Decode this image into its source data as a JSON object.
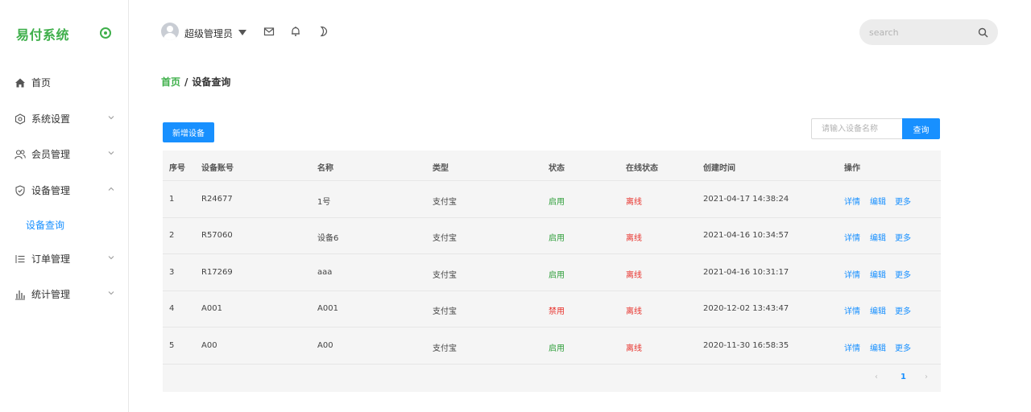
{
  "app": {
    "title": "易付系统"
  },
  "sidebar": {
    "items": [
      {
        "label": "首页",
        "icon": "home-icon"
      },
      {
        "label": "系统设置",
        "icon": "settings-icon"
      },
      {
        "label": "会员管理",
        "icon": "users-icon"
      },
      {
        "label": "设备管理",
        "icon": "shield-icon"
      },
      {
        "label": "订单管理",
        "icon": "list-icon"
      },
      {
        "label": "统计管理",
        "icon": "bar-chart-icon"
      }
    ],
    "sub_active": "设备查询"
  },
  "topbar": {
    "username": "超级管理员",
    "search_placeholder": "search"
  },
  "breadcrumb": {
    "home": "首页",
    "separator": "/",
    "current": "设备查询"
  },
  "toolbar": {
    "add_label": "新增设备",
    "query_placeholder": "请输入设备名称",
    "query_label": "查询"
  },
  "table": {
    "headers": [
      "序号",
      "设备账号",
      "名称",
      "类型",
      "状态",
      "在线状态",
      "创建时间",
      "操作"
    ],
    "rows": [
      {
        "idx": "1",
        "account": "R24677",
        "name": "1号",
        "type": "支付宝",
        "status": "启用",
        "online": "离线",
        "created": "2021-04-17 14:38:24"
      },
      {
        "idx": "2",
        "account": "R57060",
        "name": "设备6",
        "type": "支付宝",
        "status": "启用",
        "online": "离线",
        "created": "2021-04-16 10:34:57"
      },
      {
        "idx": "3",
        "account": "R17269",
        "name": "aaa",
        "type": "支付宝",
        "status": "启用",
        "online": "离线",
        "created": "2021-04-16 10:31:17"
      },
      {
        "idx": "4",
        "account": "A001",
        "name": "A001",
        "type": "支付宝",
        "status": "禁用",
        "online": "离线",
        "created": "2020-12-02 13:43:47"
      },
      {
        "idx": "5",
        "account": "A00",
        "name": "A00",
        "type": "支付宝",
        "status": "启用",
        "online": "离线",
        "created": "2020-11-30 16:58:35"
      }
    ],
    "actions": [
      "详情",
      "编辑",
      "更多"
    ]
  },
  "pagination": {
    "prev": "‹",
    "page": "1",
    "next": "›"
  },
  "colors": {
    "brand": "#3eaf4a",
    "primary": "#1890ff",
    "enabled": "#2e9e3a",
    "disabled": "#e8302a"
  }
}
